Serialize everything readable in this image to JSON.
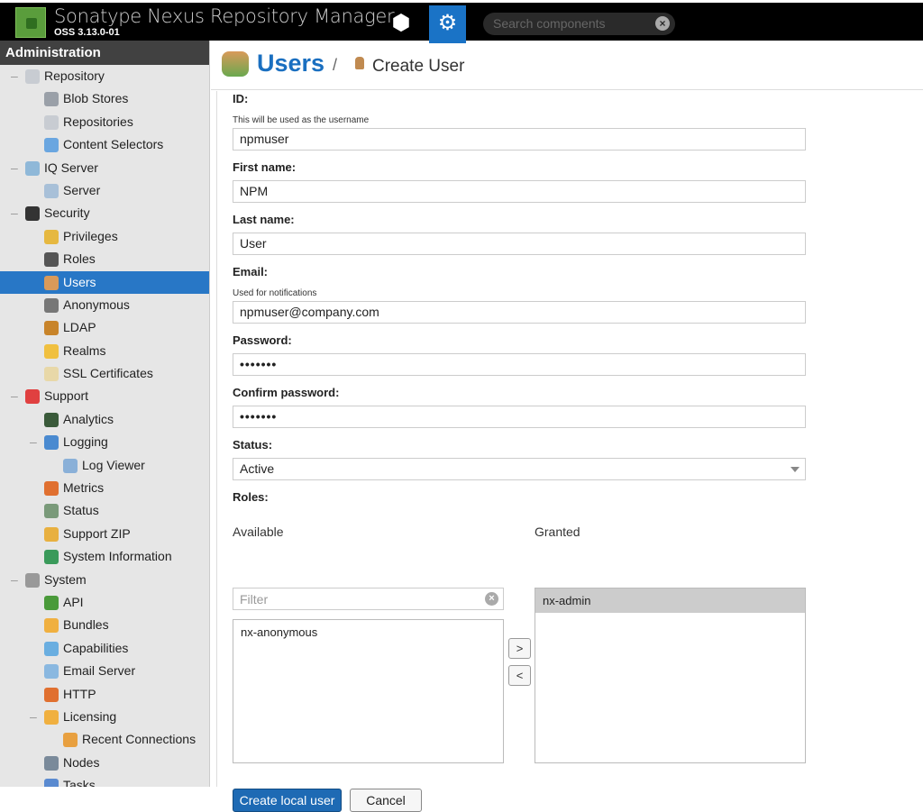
{
  "header": {
    "title": "Sonatype Nexus Repository Manager",
    "version": "OSS 3.13.0-01",
    "search_placeholder": "Search components"
  },
  "sidebar": {
    "title": "Administration",
    "items": [
      {
        "label": "Repository",
        "level": 0,
        "toggle": "–",
        "icon": "database-icon",
        "color": "#c8ccd2"
      },
      {
        "label": "Blob Stores",
        "level": 1,
        "icon": "blob-store-icon",
        "color": "#9aa0a8"
      },
      {
        "label": "Repositories",
        "level": 1,
        "icon": "database-icon",
        "color": "#c8ccd2"
      },
      {
        "label": "Content Selectors",
        "level": 1,
        "icon": "content-selector-icon",
        "color": "#6aa6e0"
      },
      {
        "label": "IQ Server",
        "level": 0,
        "toggle": "–",
        "icon": "iq-server-icon",
        "color": "#8fb8d8"
      },
      {
        "label": "Server",
        "level": 1,
        "icon": "server-icon",
        "color": "#a8c0d8"
      },
      {
        "label": "Security",
        "level": 0,
        "toggle": "–",
        "icon": "security-cap-icon",
        "color": "#333"
      },
      {
        "label": "Privileges",
        "level": 1,
        "icon": "medal-icon",
        "color": "#e6b840"
      },
      {
        "label": "Roles",
        "level": 1,
        "icon": "officer-icon",
        "color": "#555"
      },
      {
        "label": "Users",
        "level": 1,
        "icon": "users-icon",
        "color": "#d99a5a",
        "selected": true
      },
      {
        "label": "Anonymous",
        "level": 1,
        "icon": "anonymous-user-icon",
        "color": "#777"
      },
      {
        "label": "LDAP",
        "level": 1,
        "icon": "ldap-book-icon",
        "color": "#c8842a"
      },
      {
        "label": "Realms",
        "level": 1,
        "icon": "shield-icon",
        "color": "#f0c040"
      },
      {
        "label": "SSL Certificates",
        "level": 1,
        "icon": "certificate-icon",
        "color": "#e8d8a8"
      },
      {
        "label": "Support",
        "level": 0,
        "toggle": "–",
        "icon": "lifebuoy-icon",
        "color": "#e04040"
      },
      {
        "label": "Analytics",
        "level": 1,
        "icon": "analytics-icon",
        "color": "#3a5a3a"
      },
      {
        "label": "Logging",
        "level": 1,
        "toggle": "–",
        "icon": "log-book-icon",
        "color": "#4a8ad0"
      },
      {
        "label": "Log Viewer",
        "level": 2,
        "icon": "log-viewer-icon",
        "color": "#8ab0d8"
      },
      {
        "label": "Metrics",
        "level": 1,
        "icon": "pie-chart-icon",
        "color": "#e07030"
      },
      {
        "label": "Status",
        "level": 1,
        "icon": "status-chart-icon",
        "color": "#7a9a7a"
      },
      {
        "label": "Support ZIP",
        "level": 1,
        "icon": "zip-icon",
        "color": "#e8b040"
      },
      {
        "label": "System Information",
        "level": 1,
        "icon": "globe-icon",
        "color": "#3a9a5a"
      },
      {
        "label": "System",
        "level": 0,
        "toggle": "–",
        "icon": "gear-icon",
        "color": "#999"
      },
      {
        "label": "API",
        "level": 1,
        "icon": "api-icon",
        "color": "#4a9a3a"
      },
      {
        "label": "Bundles",
        "level": 1,
        "icon": "puzzle-icon",
        "color": "#f0b040"
      },
      {
        "label": "Capabilities",
        "level": 1,
        "icon": "cube-icon",
        "color": "#6aaee0"
      },
      {
        "label": "Email Server",
        "level": 1,
        "icon": "email-icon",
        "color": "#8ab8e0"
      },
      {
        "label": "HTTP",
        "level": 1,
        "icon": "truck-icon",
        "color": "#e07030"
      },
      {
        "label": "Licensing",
        "level": 1,
        "toggle": "–",
        "icon": "license-icon",
        "color": "#f0b040"
      },
      {
        "label": "Recent Connections",
        "level": 2,
        "icon": "connections-icon",
        "color": "#e8a040"
      },
      {
        "label": "Nodes",
        "level": 1,
        "icon": "nodes-icon",
        "color": "#7a8a9a"
      },
      {
        "label": "Tasks",
        "level": 1,
        "icon": "tasks-icon",
        "color": "#5a8ad0"
      }
    ]
  },
  "page": {
    "title": "Users",
    "separator": "/",
    "subtitle": "Create User"
  },
  "form": {
    "id": {
      "label": "ID:",
      "help": "This will be used as the username",
      "value": "npmuser"
    },
    "first_name": {
      "label": "First name:",
      "value": "NPM"
    },
    "last_name": {
      "label": "Last name:",
      "value": "User"
    },
    "email": {
      "label": "Email:",
      "help": "Used for notifications",
      "value": "npmuser@company.com"
    },
    "password": {
      "label": "Password:",
      "value": "•••••••"
    },
    "confirm": {
      "label": "Confirm password:",
      "value": "•••••••"
    },
    "status": {
      "label": "Status:",
      "value": "Active"
    },
    "roles": {
      "label": "Roles:",
      "available_label": "Available",
      "granted_label": "Granted",
      "filter_placeholder": "Filter",
      "available": [
        "nx-anonymous"
      ],
      "granted": [
        "nx-admin"
      ],
      "add": ">",
      "remove": "<"
    },
    "submit": "Create local user",
    "cancel": "Cancel"
  }
}
